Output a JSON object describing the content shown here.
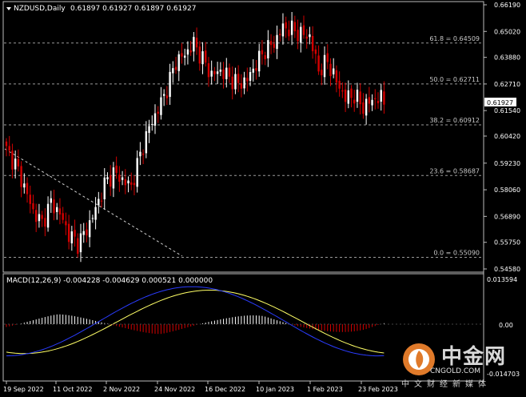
{
  "header": {
    "symbol_label": "NZDUSD,Daily",
    "ohlc": "0.61897 0.61927 0.61897 0.61927"
  },
  "current_price": "0.61927",
  "price_axis_labels": [
    "0.66190",
    "0.65020",
    "0.63880",
    "0.62710",
    "0.61540",
    "0.60420",
    "0.59230",
    "0.58060",
    "0.56890",
    "0.55750",
    "0.54580"
  ],
  "fib_levels": [
    {
      "label": "61.8 = 0.64509",
      "value": 0.64509
    },
    {
      "label": "50.0 = 0.62711",
      "value": 0.62711
    },
    {
      "label": "38.2 = 0.60912",
      "value": 0.60912
    },
    {
      "label": "23.6 = 0.58687",
      "value": 0.58687
    },
    {
      "label": "0.0 = 0.55090",
      "value": 0.5509
    }
  ],
  "date_axis_labels": [
    "19 Sep 2022",
    "11 Oct 2022",
    "2 Nov 2022",
    "24 Nov 2022",
    "16 Dec 2022",
    "10 Jan 2023",
    "1 Feb 2023",
    "23 Feb 2023"
  ],
  "macd": {
    "title": "MACD(12,26,9) -0.004228 -0.004629 0.000521 0.000000",
    "axis_labels": [
      "0.013594",
      "0.00",
      "-0.014703"
    ]
  },
  "colors": {
    "bull": "#ffffff",
    "bear": "#d40000",
    "macd_line": "#2a3cff",
    "signal_line": "#ffff66",
    "grid": "#9a9a9a"
  },
  "watermark": {
    "title": "中金网",
    "subtitle": "CNGOLD.COM",
    "tagline": "中文财经新媒体"
  }
}
